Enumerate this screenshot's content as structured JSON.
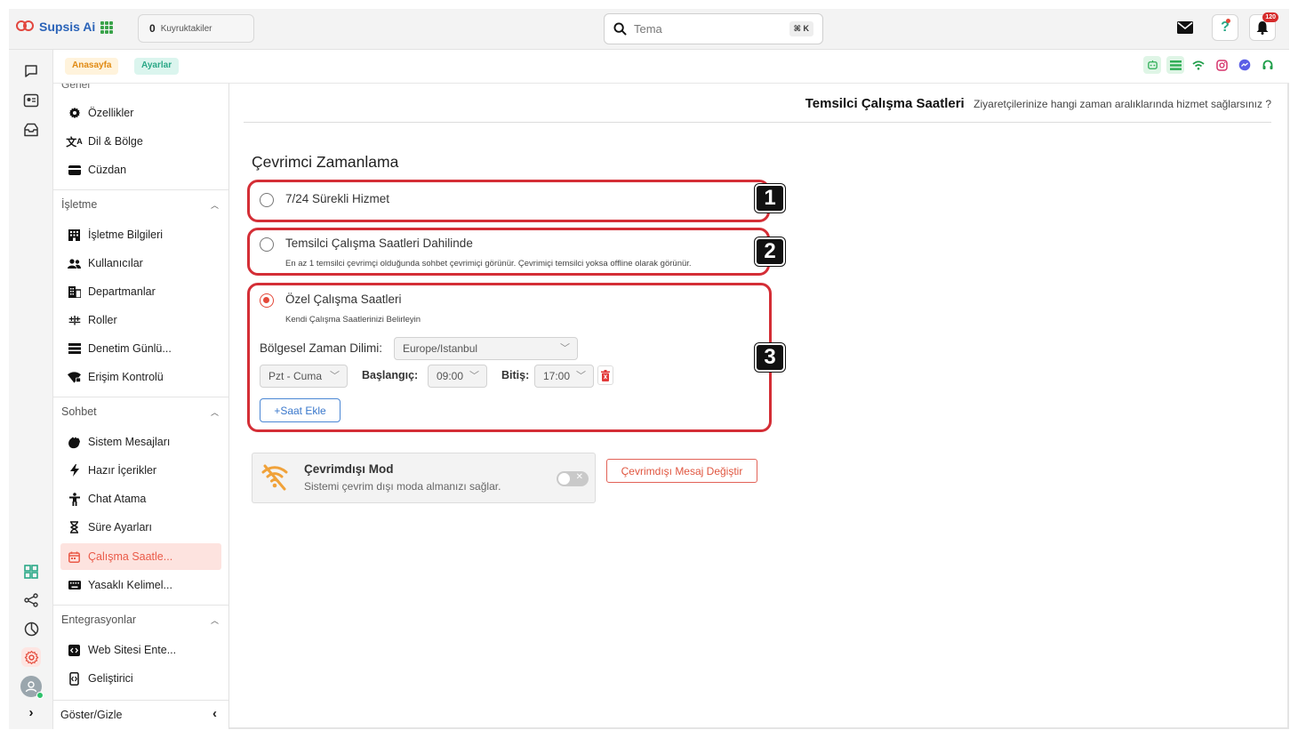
{
  "app": {
    "name": "Supsis Ai"
  },
  "topbar": {
    "queue_count": "0",
    "queue_label": "Kuyruktakiler",
    "search_placeholder": "Tema",
    "search_shortcut": "⌘ K",
    "notification_count": "120"
  },
  "breadcrumb": {
    "home": "Anasayfa",
    "settings": "Ayarlar"
  },
  "sidebar": {
    "cut_label": "Genel",
    "general_items": [
      {
        "label": "Özellikler",
        "icon": "gear-icon"
      },
      {
        "label": "Dil & Bölge",
        "icon": "translate-icon"
      },
      {
        "label": "Cüzdan",
        "icon": "wallet-icon"
      }
    ],
    "business": {
      "title": "İşletme",
      "items": [
        {
          "label": "İşletme Bilgileri",
          "icon": "building-icon"
        },
        {
          "label": "Kullanıcılar",
          "icon": "users-icon"
        },
        {
          "label": "Departmanlar",
          "icon": "department-icon"
        },
        {
          "label": "Roller",
          "icon": "roles-icon"
        },
        {
          "label": "Denetim Günlü...",
          "icon": "audit-log-icon"
        },
        {
          "label": "Erişim Kontrolü",
          "icon": "access-icon"
        }
      ]
    },
    "chat": {
      "title": "Sohbet",
      "items": [
        {
          "label": "Sistem Mesajları",
          "icon": "wave-hand-icon"
        },
        {
          "label": "Hazır İçerikler",
          "icon": "bolt-icon"
        },
        {
          "label": "Chat Atama",
          "icon": "assign-icon"
        },
        {
          "label": "Süre Ayarları",
          "icon": "hourglass-icon"
        },
        {
          "label": "Çalışma Saatle...",
          "icon": "calendar-icon"
        },
        {
          "label": "Yasaklı Kelimel...",
          "icon": "keyboard-icon"
        }
      ]
    },
    "integrations": {
      "title": "Entegrasyonlar",
      "items": [
        {
          "label": "Web Sitesi Ente...",
          "icon": "code-icon"
        },
        {
          "label": "Geliştirici",
          "icon": "developer-icon"
        }
      ]
    },
    "toggle_label": "Göster/Gizle"
  },
  "page": {
    "title": "Temsilci Çalışma Saatleri",
    "subtitle": "Ziyaretçilerinize hangi zaman aralıklarında hizmet sağlarsınız ?",
    "section_title": "Çevrimci Zamanlama",
    "options": [
      {
        "number": "1",
        "label": "7/24 Sürekli Hizmet",
        "desc": "",
        "selected": false
      },
      {
        "number": "2",
        "label": "Temsilci Çalışma Saatleri Dahilinde",
        "desc": "En az 1 temsilci çevrimçi olduğunda sohbet çevrimiçi görünür. Çevrimiçi temsilci yoksa offline olarak görünür.",
        "selected": false
      },
      {
        "number": "3",
        "label": "Özel Çalışma Saatleri",
        "desc": "Kendi Çalışma Saatlerinizi Belirleyin",
        "selected": true
      }
    ],
    "timezone_label": "Bölgesel Zaman Dilimi:",
    "timezone_value": "Europe/Istanbul",
    "day_range": "Pzt - Cuma",
    "start_label": "Başlangıç:",
    "start_value": "09:00",
    "end_label": "Bitiş:",
    "end_value": "17:00",
    "add_hours": "+Saat Ekle",
    "offline": {
      "title": "Çevrimdışı Mod",
      "desc": "Sistemi çevrim dışı moda almanızı sağlar.",
      "enabled": false,
      "change_button": "Çevrimdışı Mesaj Değiştir"
    }
  },
  "colors": {
    "accent": "#e4493a",
    "highlight": "#d42e36",
    "brand_blue": "#2a63b8",
    "home_crumb": "#e08a13",
    "settings_crumb": "#2aa887"
  }
}
